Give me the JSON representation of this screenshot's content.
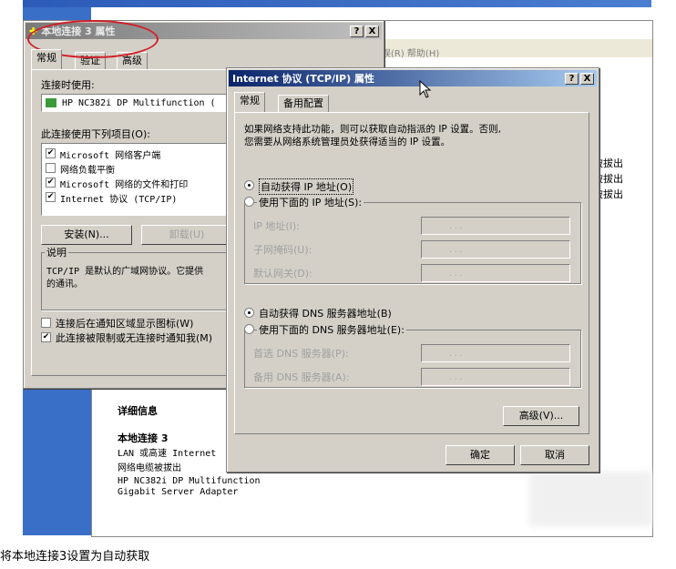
{
  "bg": {
    "menu_right": "误(R)   帮助(H)",
    "status_lines": [
      "被拔出",
      "被拔出",
      "被拔出"
    ],
    "details": {
      "header": "详细信息",
      "name": "本地连接 3",
      "line1": "LAN 或高速 Internet",
      "line2": "网络电缆被拔出",
      "line3": "HP NC382i DP Multifunction",
      "line4": "Gigabit Server Adapter"
    }
  },
  "props": {
    "title": "本地连接 3 属性",
    "help": "?",
    "close": "X",
    "tabs": [
      "常规",
      "验证",
      "高级"
    ],
    "connect_using_label": "连接时使用:",
    "adapter": "HP NC382i DP Multifunction (",
    "items_label": "此连接使用下列项目(O):",
    "items": [
      {
        "checked": true,
        "label": "Microsoft 网络客户端"
      },
      {
        "checked": false,
        "label": "网络负载平衡"
      },
      {
        "checked": true,
        "label": "Microsoft 网络的文件和打印"
      },
      {
        "checked": true,
        "label": "Internet 协议 (TCP/IP)"
      }
    ],
    "install": "安装(N)...",
    "uninstall": "卸载(U)",
    "desc_label": "说明",
    "desc_text": "TCP/IP 是默认的广域网协议。它提供",
    "desc_text2": "的通讯。",
    "opt1": "连接后在通知区域显示图标(W)",
    "opt2": "此连接被限制或无连接时通知我(M)"
  },
  "tcpip": {
    "title": "Internet 协议 (TCP/IP) 属性",
    "help": "?",
    "close": "X",
    "tabs": [
      "常规",
      "备用配置"
    ],
    "intro1": "如果网络支持此功能，则可以获取自动指派的 IP 设置。否则,",
    "intro2": "您需要从网络系统管理员处获得适当的 IP 设置。",
    "auto_ip": "自动获得 IP 地址(O)",
    "manual_ip": "使用下面的 IP 地址(S):",
    "ip_label": "IP 地址(I):",
    "mask_label": "子网掩码(U):",
    "gateway_label": "默认网关(D):",
    "auto_dns": "自动获得 DNS 服务器地址(B)",
    "manual_dns": "使用下面的 DNS 服务器地址(E):",
    "dns1_label": "首选 DNS 服务器(P):",
    "dns2_label": "备用 DNS 服务器(A):",
    "advanced": "高级(V)...",
    "ok": "确定",
    "cancel": "取消",
    "ip_dots": ".     .     ."
  },
  "caption": "将本地连接3设置为自动获取",
  "colors": {
    "annotation": "#d0202a",
    "title_active": "#0a246a"
  }
}
